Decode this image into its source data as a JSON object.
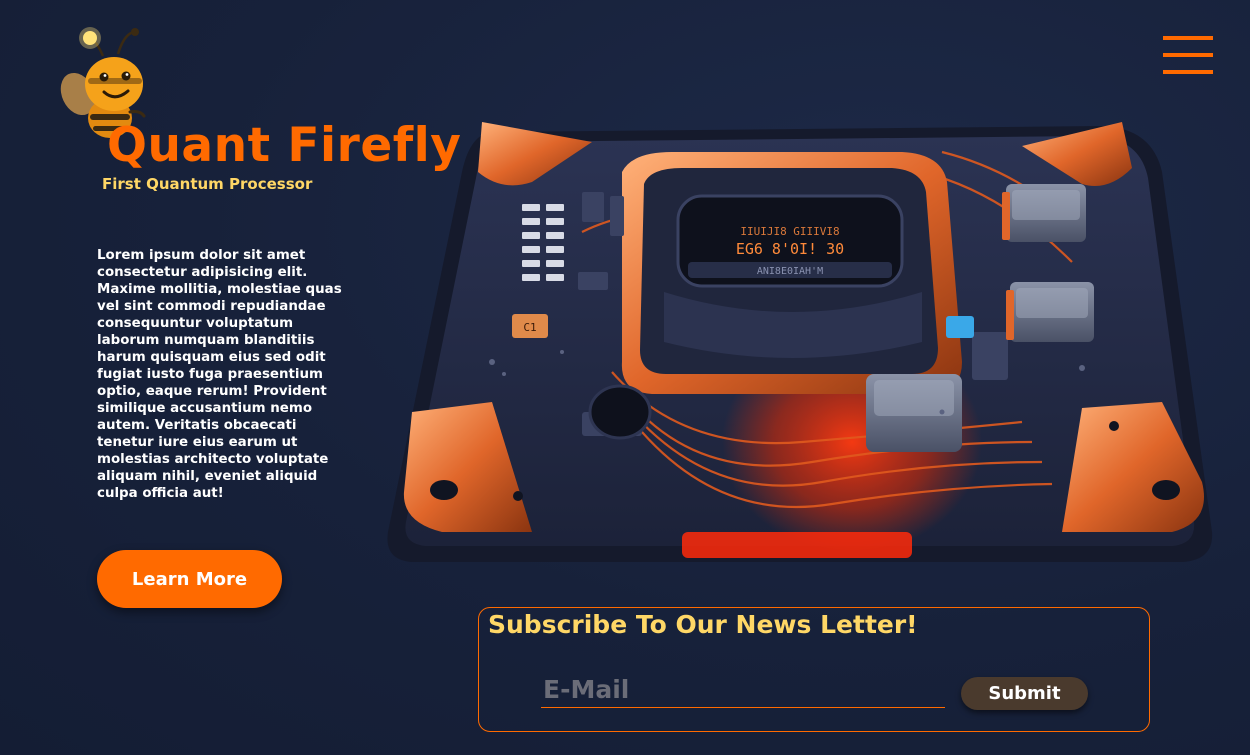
{
  "brand": {
    "name": "Quant Firefly",
    "tagline": "First Quantum Processor",
    "logo_icon": "bee-icon"
  },
  "header": {
    "menu_icon": "hamburger-menu-icon"
  },
  "hero": {
    "description": "Lorem ipsum dolor sit amet consectetur adipisicing elit. Maxime mollitia, molestiae quas vel sint commodi repudiandae consequuntur voluptatum laborum numquam blanditiis harum quisquam eius sed odit fugiat iusto fuga praesentium optio, eaque rerum! Provident similique accusantium nemo autem. Veritatis obcaecati tenetur iure eius earum ut molestias architecto voluptate aliquam nihil, eveniet aliquid culpa officia aut!",
    "learn_more_label": "Learn More",
    "image": "quantum-processor-illustration"
  },
  "subscribe": {
    "title": "Subscribe To Our News Letter!",
    "email_placeholder": "E-Mail",
    "email_value": "",
    "submit_label": "Submit"
  },
  "colors": {
    "background": "#17213a",
    "accent": "#ff6a00",
    "highlight": "#ffd766",
    "submit_bg": "#4a3a2d"
  }
}
